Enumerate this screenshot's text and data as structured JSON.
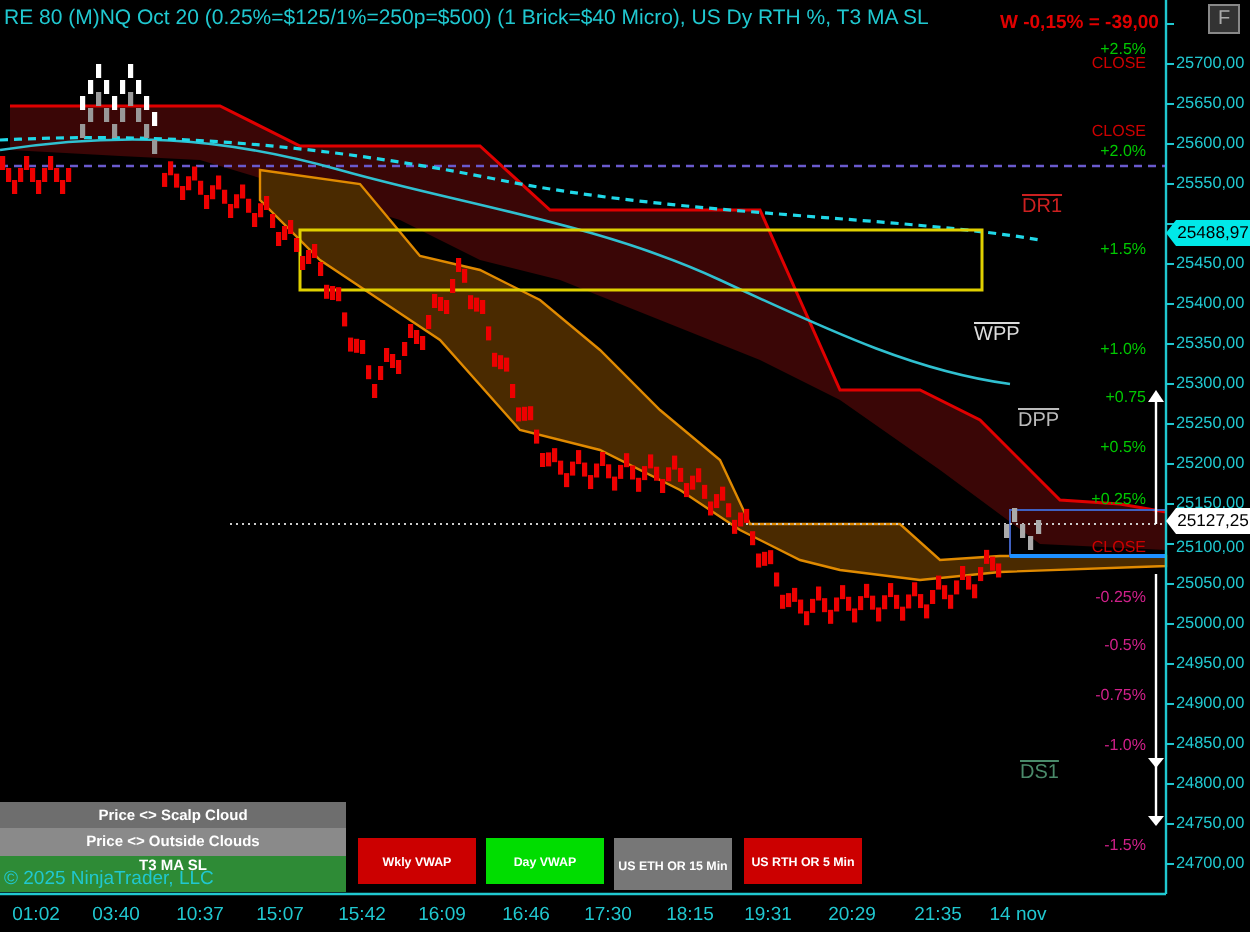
{
  "chart": {
    "title": "RE 80 (M)NQ Oct 20  (0.25%=$125/1%=250p=$500)  (1 Brick=$40 Micro), US Dy RTH %, T3 MA SL",
    "pnl": "W -0,15% = -39,00",
    "corner_button": "F",
    "price_axis": [
      "25700,00",
      "25650,00",
      "25600,00",
      "25550,00",
      "25450,00",
      "25400,00",
      "25350,00",
      "25300,00",
      "25250,00",
      "25200,00",
      "25150,00",
      "25100,00",
      "25050,00",
      "25000,00",
      "24950,00",
      "24900,00",
      "24850,00",
      "24800,00",
      "24750,00",
      "24700,00"
    ],
    "price_markers": [
      {
        "label": "25488,97",
        "kind": "indicator"
      },
      {
        "label": "25127,25",
        "kind": "last"
      }
    ],
    "time_axis": [
      "01:02",
      "03:40",
      "10:37",
      "15:07",
      "15:42",
      "16:09",
      "16:46",
      "17:30",
      "18:15",
      "19:31",
      "20:29",
      "21:35",
      "14 nov"
    ],
    "right_labels": [
      {
        "label": "+2.5%",
        "kind": "positive"
      },
      {
        "label": "CLOSE",
        "kind": "close"
      },
      {
        "label": "CLOSE",
        "kind": "close"
      },
      {
        "label": "+2.0%",
        "kind": "positive"
      },
      {
        "label": "+1.5%",
        "kind": "positive"
      },
      {
        "label": "+1.0%",
        "kind": "positive"
      },
      {
        "label": "+0.75",
        "kind": "positive"
      },
      {
        "label": "+0.5%",
        "kind": "positive"
      },
      {
        "label": "+0.25%",
        "kind": "positive"
      },
      {
        "label": "CLOSE",
        "kind": "close"
      },
      {
        "label": "-0.25%",
        "kind": "negative"
      },
      {
        "label": "-0.5%",
        "kind": "negative"
      },
      {
        "label": "-0.75%",
        "kind": "negative"
      },
      {
        "label": "-1.0%",
        "kind": "negative"
      },
      {
        "label": "-1.5%",
        "kind": "negative"
      }
    ],
    "pivots": [
      {
        "label": "DR1",
        "kind": "resistance"
      },
      {
        "label": "WPP",
        "kind": "weekly"
      },
      {
        "label": "DPP",
        "kind": "daily"
      },
      {
        "label": "DS1",
        "kind": "support"
      }
    ],
    "legend": [
      {
        "label": "Price <> Scalp Cloud",
        "color": "#6e6e6e"
      },
      {
        "label": "Price <> Outside Clouds",
        "color": "#8a8a8a"
      },
      {
        "label": "T3 MA SL",
        "color": "#2e8b36"
      }
    ],
    "copyright": "© 2025 NinjaTrader, LLC",
    "indicator_buttons": [
      {
        "label": "Wkly VWAP",
        "color": "#cc0000"
      },
      {
        "label": "Day VWAP",
        "color": "#00dd00"
      },
      {
        "label": "US ETH OR 15 Min",
        "color": "#777777"
      },
      {
        "label": "US RTH OR 5 Min",
        "color": "#cc0000"
      }
    ]
  }
}
